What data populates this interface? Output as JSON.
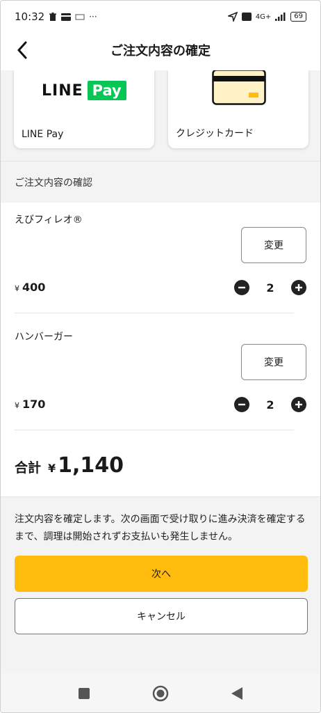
{
  "status_bar": {
    "time": "10:32",
    "dots": "···",
    "network": "4G+",
    "battery": "69"
  },
  "header": {
    "title": "ご注文内容の確定"
  },
  "payment_methods": [
    {
      "logo_text_line": "LINE",
      "logo_text_pay": "Pay",
      "label": "LINE Pay"
    },
    {
      "label": "クレジットカード"
    }
  ],
  "section": {
    "title": "ご注文内容の確認"
  },
  "items": [
    {
      "name": "えびフィレオ®",
      "change_label": "変更",
      "currency": "¥",
      "price": "400",
      "quantity": "2"
    },
    {
      "name": "ハンバーガー",
      "change_label": "変更",
      "currency": "¥",
      "price": "170",
      "quantity": "2"
    }
  ],
  "total": {
    "label": "合計",
    "currency": "¥",
    "value": "1,140"
  },
  "footer": {
    "notice": "注文内容を確定します。次の画面で受け取りに進み決済を確定するまで、調理は開始されずお支払いも発生しません。",
    "next_label": "次へ",
    "cancel_label": "キャンセル"
  },
  "colors": {
    "accent": "#ffbc0d",
    "line_green": "#06c755"
  },
  "icons": {
    "back": "chevron-left-icon",
    "minus": "minus-circle-icon",
    "plus": "plus-circle-icon",
    "credit_card": "credit-card-icon"
  }
}
